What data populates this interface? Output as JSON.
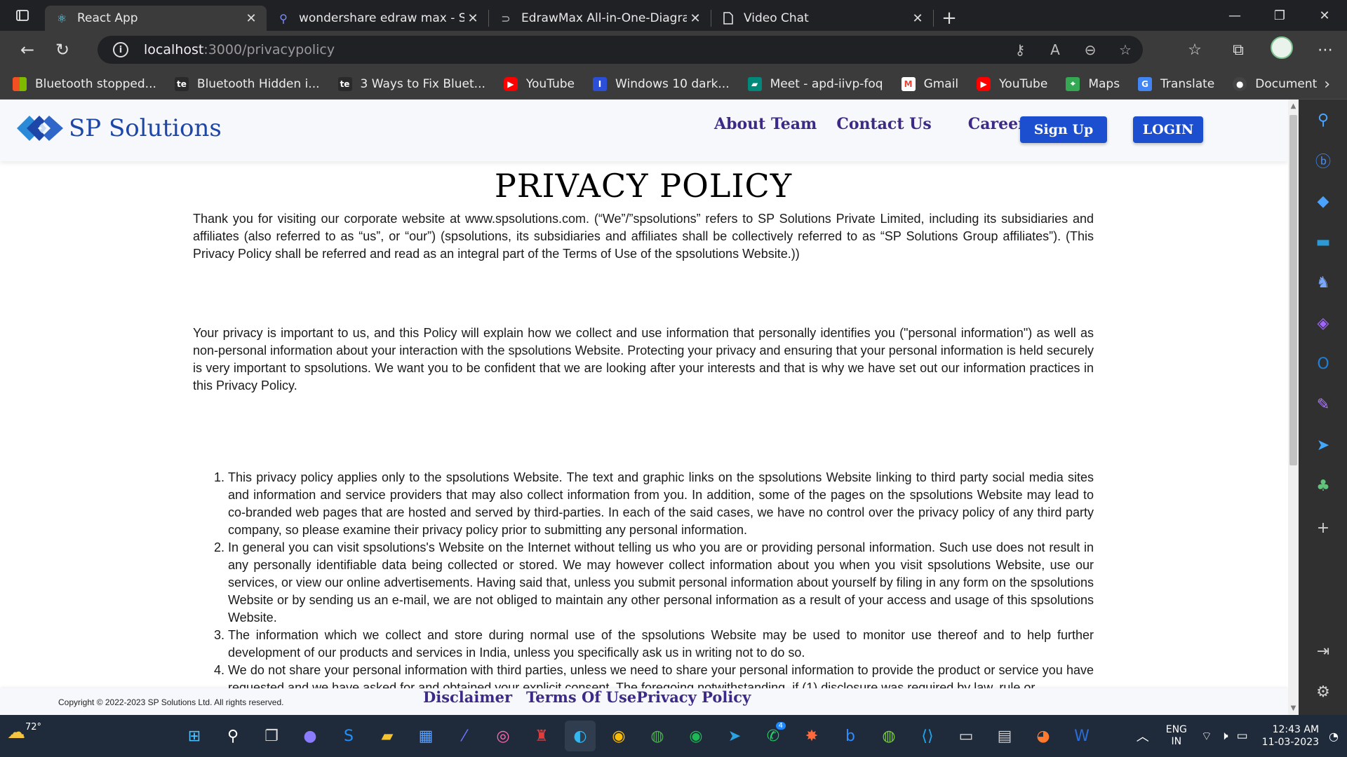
{
  "browser": {
    "tabs": [
      {
        "title": "React App",
        "icon": "react-icon",
        "active": true
      },
      {
        "title": "wondershare edraw max - Search",
        "icon": "search-icon"
      },
      {
        "title": "EdrawMax All-in-One-Diagram Software",
        "icon": "edrawmax-icon"
      },
      {
        "title": "Video Chat",
        "icon": "page-icon"
      }
    ],
    "url_host": "localhost",
    "url_path": ":3000/privacypolicy",
    "bookmarks": [
      {
        "label": "Bluetooth stopped...",
        "icon": "windows-logo-icon",
        "color": "#f25022"
      },
      {
        "label": "Bluetooth Hidden i...",
        "icon": "te-icon",
        "color": "#2a2a2a"
      },
      {
        "label": "3 Ways to Fix Bluet...",
        "icon": "te-icon",
        "color": "#2a2a2a"
      },
      {
        "label": "YouTube",
        "icon": "youtube-icon",
        "color": "#ff0000"
      },
      {
        "label": "Windows 10 dark...",
        "icon": "bookmark-i-icon",
        "color": "#2b4fd6"
      },
      {
        "label": "Meet - apd-iivp-foq",
        "icon": "google-meet-icon",
        "color": "#00897b"
      },
      {
        "label": "Gmail",
        "icon": "gmail-icon",
        "color": "#ea4335"
      },
      {
        "label": "YouTube",
        "icon": "youtube-icon",
        "color": "#ff0000"
      },
      {
        "label": "Maps",
        "icon": "google-maps-icon",
        "color": "#34a853"
      },
      {
        "label": "Translate",
        "icon": "google-translate-icon",
        "color": "#4285f4"
      },
      {
        "label": "Document",
        "icon": "github-icon",
        "color": "#444444"
      }
    ]
  },
  "site": {
    "brand": "SP Solutions",
    "nav": {
      "about": "About Team",
      "contact": "Contact Us",
      "careers": "Careers"
    },
    "signup_label": "Sign Up",
    "login_label": "LOGIN",
    "brand_color": "#1b4fcf",
    "nav_color": "#3c2a86"
  },
  "policy": {
    "title": "PRIVACY POLICY",
    "intro": "Thank you for visiting our corporate website at www.spsolutions.com. (“We”/”spsolutions” refers to SP Solutions Private Limited, including its subsidiaries and affiliates (also referred to as “us”, or “our”) (spsolutions, its subsidiaries and affiliates shall be collectively referred to as “SP Solutions Group affiliates”). (This Privacy Policy shall be referred and read as an integral part of the Terms of Use of the spsolutions Website.))",
    "privacy_para": "Your privacy is important to us, and this Policy will explain how we collect and use information that personally identifies you (\"personal information\") as well as non-personal information about your interaction with the spsolutions Website. Protecting your privacy and ensuring that your personal information is held securely is very important to spsolutions. We want you to be confident that we are looking after your interests and that is why we have set out our information practices in this Privacy Policy.",
    "items": [
      "This privacy policy applies only to the spsolutions Website. The text and graphic links on the spsolutions Website linking to third party social media sites and information and service providers that may also collect information from you. In addition, some of the pages on the spsolutions Website may lead to co-branded web pages that are hosted and served by third-parties. In each of the said cases, we have no control over the privacy policy of any third party company, so please examine their privacy policy prior to submitting any personal information.",
      "In general you can visit spsolutions's Website on the Internet without telling us who you are or providing personal information. Such use does not result in any personally identifiable data being collected or stored. We may however collect information about you when you visit spsolutions Website, use our services, or view our online advertisements. Having said that, unless you submit personal information about yourself by filing in any form on the spsolutions Website or by sending us an e-mail, we are not obliged to maintain any other personal information as a result of your access and usage of this spsolutions Website.",
      "The information which we collect and store during normal use of the spsolutions Website may be used to monitor use thereof and to help further development of our products and services in India, unless you specifically ask us in writing not to do so.",
      "We do not share your personal information with third parties, unless we need to share your personal information to provide the product or service you have requested and we have asked for and obtained your explicit consent. The foregoing notwithstanding, if (1) disclosure was required by law, rule or"
    ]
  },
  "footer": {
    "copyright": "Copyright © 2022-2023 SP Solutions Ltd. All rights reserved.",
    "disclaimer": "Disclaimer",
    "terms": "Terms Of Use",
    "privacy": "Privacy Policy"
  },
  "taskbar": {
    "weather_temp": "72°",
    "lang_line1": "ENG",
    "lang_line2": "IN",
    "time": "12:43 AM",
    "date": "11-03-2023",
    "whatsapp_badge": "4"
  }
}
